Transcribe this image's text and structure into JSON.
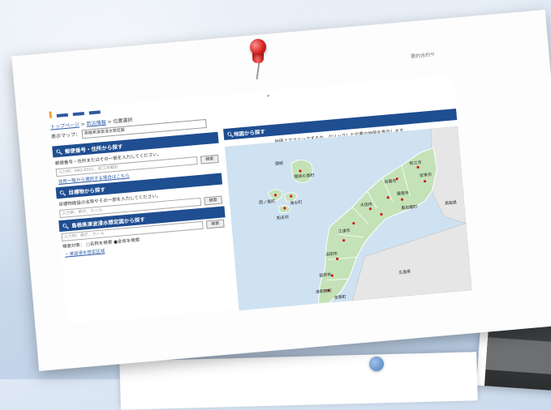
{
  "page": {
    "top_right_text": "要約合約サ",
    "logo": "",
    "breadcrumb": {
      "home": "トップページ",
      "sep1": ">",
      "section": "防災情報",
      "sep2": ">",
      "current": "位置選択"
    }
  },
  "display_map": {
    "label": "表示マップ：",
    "selected": "島根県津波浸水想定図"
  },
  "postal_section": {
    "title": "郵便番号・住所から探す",
    "description": "郵便番号・住所またはその一部を入力してください。",
    "placeholder": "入力例：690-8501、松江市殿町",
    "button": "検索",
    "link": "住所一覧から選択する場合はこちら"
  },
  "landmark_section": {
    "title": "目標物から探す",
    "description": "目標物施設の名称やその一部を入力してください。",
    "placeholder": "入力例：県庁、ホール",
    "button": "検索"
  },
  "tsunami_section": {
    "title": "島根県津波浸水想定図から探す",
    "placeholder": "入力例：県庁、ホール",
    "button": "検索",
    "search_target_label": "検索対象：",
    "radio_name": "名称を検索",
    "radio_all": "全体を検索",
    "link": "津波浸水想定区域"
  },
  "map_section": {
    "title": "地図から探す",
    "note": "地図上でクリックするか、クリックした位置の地図を表示します。",
    "labels": {
      "oki": "隠岐",
      "nishinoshima": "西ノ島町",
      "ama": "海士町",
      "chibu": "知夫村",
      "okinoshima": "隠岐の島町",
      "izumo": "出雲市",
      "matsue": "松江市",
      "yasugi": "安来市",
      "unnan": "雲南市",
      "okuizumo": "奥出雲町",
      "oda": "大田市",
      "gotsu": "江津市",
      "hamada": "浜田市",
      "masuda": "益田市",
      "tsuwano": "津和野町",
      "yoshika": "吉賀町",
      "hiroshima": "広島県",
      "tottori": "鳥取県"
    }
  },
  "colors": {
    "header": "#1f4e91",
    "land": "#c4e2b8",
    "sea": "#cfe2f2",
    "pin": "#d11c1c"
  }
}
